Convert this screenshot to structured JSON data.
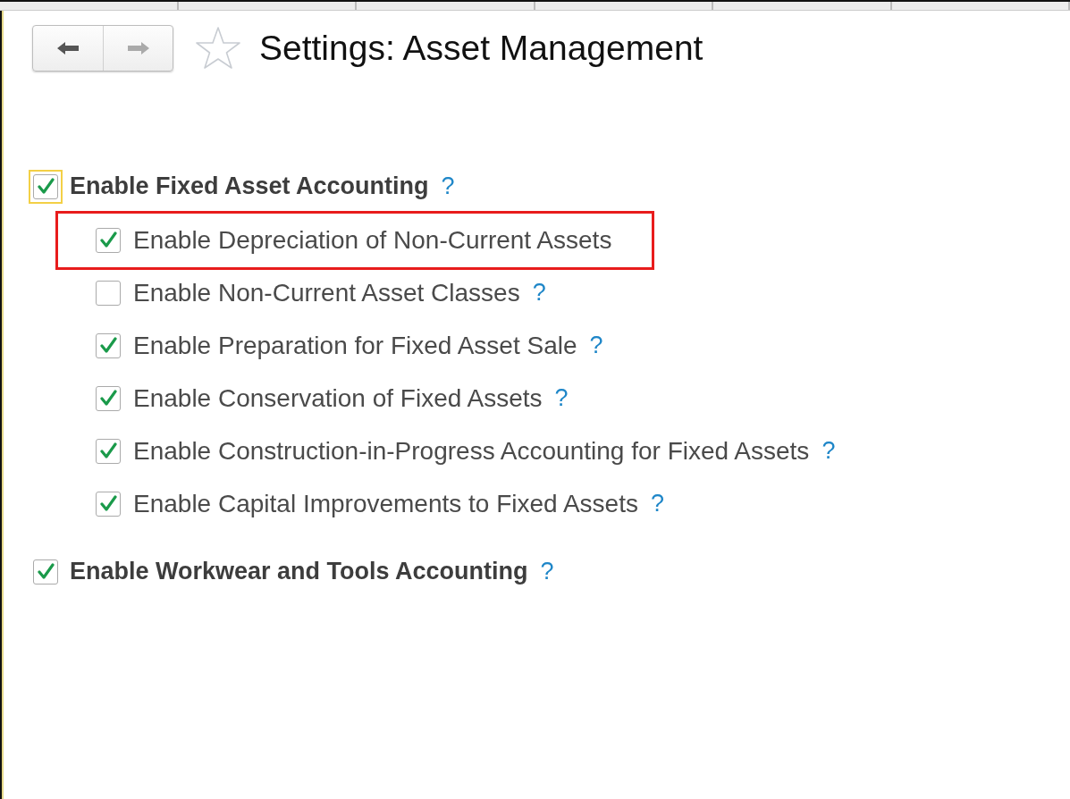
{
  "window": {
    "title": "Settings: Asset Management"
  },
  "navigation": {
    "back": {
      "disabled": false
    },
    "forward": {
      "disabled": true
    },
    "favorite": {
      "on": false
    }
  },
  "options": [
    {
      "label": "Enable Fixed Asset Accounting",
      "checked": true,
      "focused": true,
      "help": "?",
      "children": [
        {
          "label": "Enable Depreciation of Non-Current Assets",
          "checked": true,
          "focused": false,
          "highlighted": true
        },
        {
          "label": "Enable Non-Current Asset Classes",
          "checked": false,
          "focused": false,
          "help": "?"
        },
        {
          "label": "Enable Preparation for Fixed Asset Sale",
          "checked": true,
          "focused": false,
          "help": "?"
        },
        {
          "label": "Enable Conservation of Fixed Assets",
          "checked": true,
          "focused": false,
          "help": "?"
        },
        {
          "label": "Enable Construction-in-Progress Accounting for Fixed Assets",
          "checked": true,
          "focused": false,
          "help": "?"
        },
        {
          "label": "Enable Capital Improvements to Fixed Assets",
          "checked": true,
          "focused": false,
          "help": "?"
        }
      ]
    },
    {
      "label": "Enable Workwear and Tools Accounting",
      "checked": true,
      "focused": false,
      "help": "?"
    }
  ]
}
